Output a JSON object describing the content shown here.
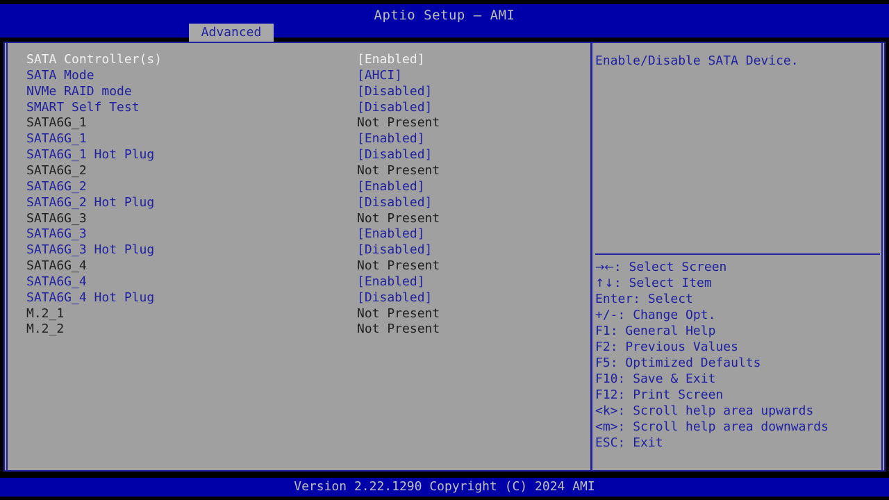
{
  "window": {
    "title": "Aptio Setup – AMI",
    "version_footer": "Version 2.22.1290 Copyright (C) 2024 AMI"
  },
  "tabs": [
    {
      "label": "Advanced",
      "active": true
    }
  ],
  "colors": {
    "titlebar_bg": "#0000a8",
    "panel_bg": "#a0a0a0",
    "frame_border": "#2020a0",
    "option_text": "#2020a0",
    "selected_text": "#f0f0f0",
    "readonly_text": "#202020",
    "footer_text": "#bfbfbf",
    "tab_active_bg": "#a8a8a8"
  },
  "settings": {
    "rows": [
      {
        "label": "SATA Controller(s)",
        "value": "[Enabled]",
        "state": "selected",
        "interactable": true
      },
      {
        "label": "SATA Mode",
        "value": "[AHCI]",
        "state": "option",
        "interactable": true
      },
      {
        "label": "NVMe RAID mode",
        "value": "[Disabled]",
        "state": "option",
        "interactable": true
      },
      {
        "label": "SMART Self Test",
        "value": "[Disabled]",
        "state": "option",
        "interactable": true
      },
      {
        "label": "SATA6G_1",
        "value": "Not Present",
        "state": "readonly",
        "interactable": false
      },
      {
        "label": "SATA6G_1",
        "value": "[Enabled]",
        "state": "option",
        "interactable": true
      },
      {
        "label": "SATA6G_1 Hot Plug",
        "value": "[Disabled]",
        "state": "option",
        "interactable": true
      },
      {
        "label": "SATA6G_2",
        "value": "Not Present",
        "state": "readonly",
        "interactable": false
      },
      {
        "label": "SATA6G_2",
        "value": "[Enabled]",
        "state": "option",
        "interactable": true
      },
      {
        "label": "SATA6G_2 Hot Plug",
        "value": "[Disabled]",
        "state": "option",
        "interactable": true
      },
      {
        "label": "SATA6G_3",
        "value": "Not Present",
        "state": "readonly",
        "interactable": false
      },
      {
        "label": "SATA6G_3",
        "value": "[Enabled]",
        "state": "option",
        "interactable": true
      },
      {
        "label": "SATA6G_3 Hot Plug",
        "value": "[Disabled]",
        "state": "option",
        "interactable": true
      },
      {
        "label": "SATA6G_4",
        "value": "Not Present",
        "state": "readonly",
        "interactable": false
      },
      {
        "label": "SATA6G_4",
        "value": "[Enabled]",
        "state": "option",
        "interactable": true
      },
      {
        "label": "SATA6G_4 Hot Plug",
        "value": "[Disabled]",
        "state": "option",
        "interactable": true
      },
      {
        "label": "M.2_1",
        "value": "Not Present",
        "state": "readonly",
        "interactable": false
      },
      {
        "label": "M.2_2",
        "value": "Not Present",
        "state": "readonly",
        "interactable": false
      }
    ]
  },
  "help": {
    "description": "Enable/Disable SATA Device.",
    "keys": [
      {
        "glyph": "→←",
        "key": "",
        "sep": ": ",
        "action": "Select Screen"
      },
      {
        "glyph": "↑↓",
        "key": "",
        "sep": ": ",
        "action": "Select Item"
      },
      {
        "glyph": "",
        "key": "Enter",
        "sep": ": ",
        "action": "Select"
      },
      {
        "glyph": "",
        "key": "+/-",
        "sep": ": ",
        "action": "Change Opt."
      },
      {
        "glyph": "",
        "key": "F1",
        "sep": ": ",
        "action": "General Help"
      },
      {
        "glyph": "",
        "key": "F2",
        "sep": ": ",
        "action": "Previous Values"
      },
      {
        "glyph": "",
        "key": "F5",
        "sep": ": ",
        "action": "Optimized Defaults"
      },
      {
        "glyph": "",
        "key": "F10",
        "sep": ": ",
        "action": "Save & Exit"
      },
      {
        "glyph": "",
        "key": "F12",
        "sep": ": ",
        "action": "Print Screen"
      },
      {
        "glyph": "",
        "key": "<k>",
        "sep": ": ",
        "action": "Scroll help area upwards"
      },
      {
        "glyph": "",
        "key": "<m>",
        "sep": ": ",
        "action": "Scroll help area downwards"
      },
      {
        "glyph": "",
        "key": "ESC",
        "sep": ": ",
        "action": "Exit"
      }
    ]
  }
}
